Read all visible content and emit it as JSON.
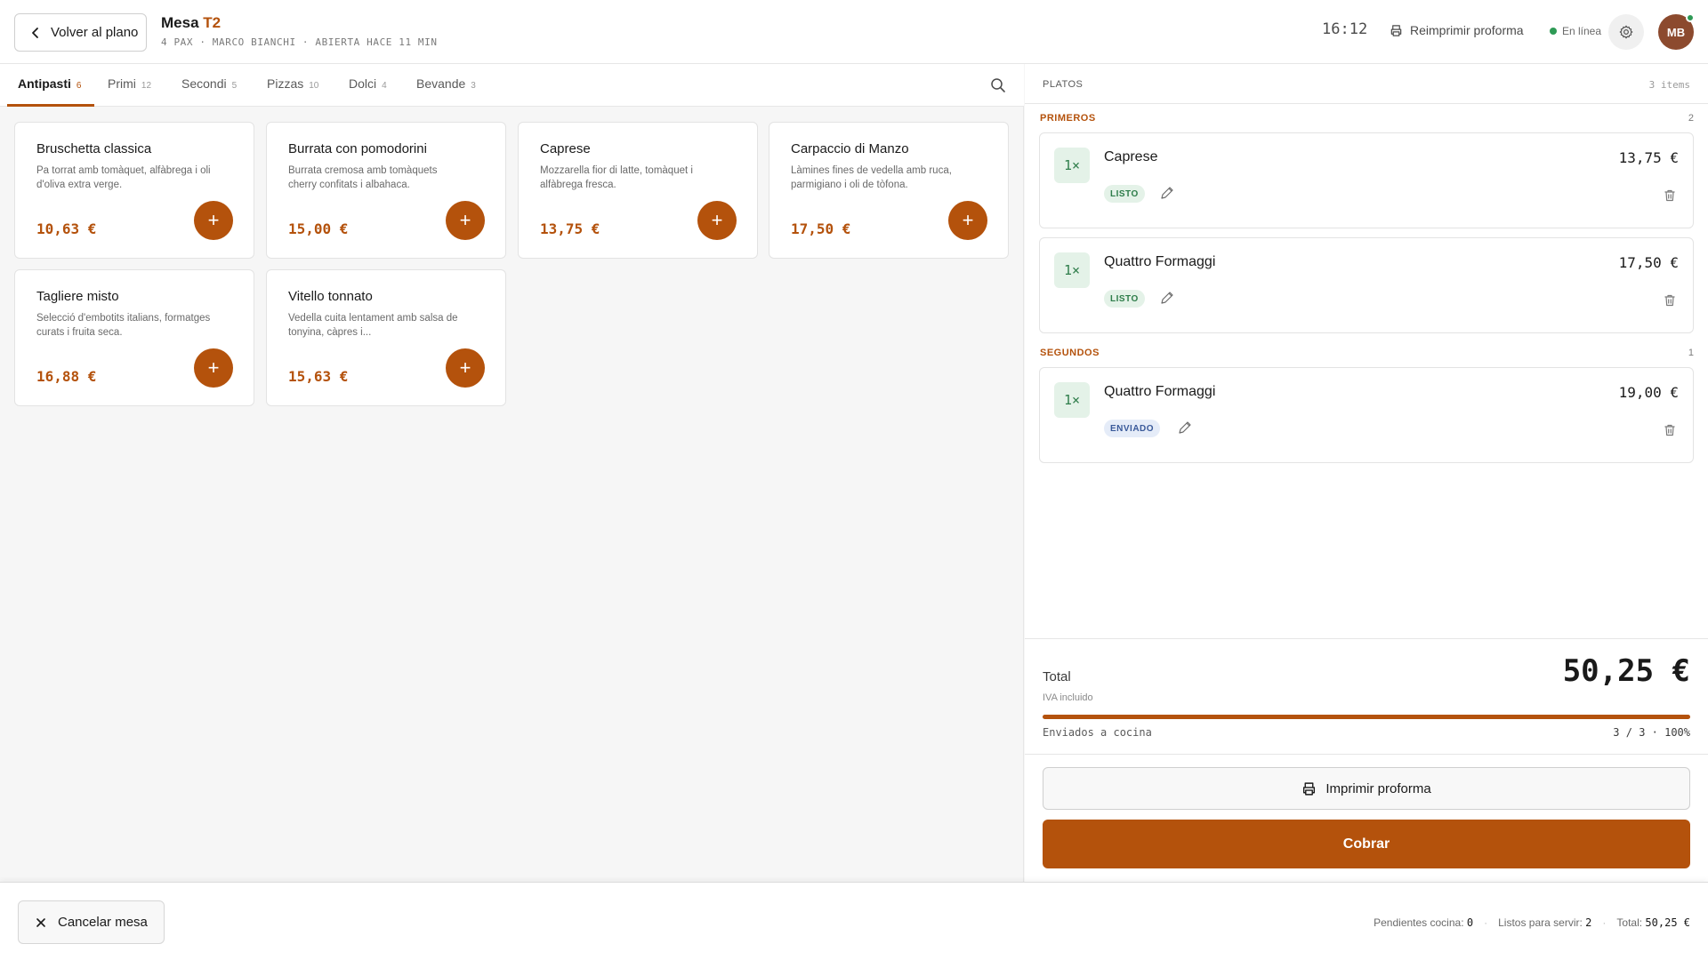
{
  "header": {
    "back_label": "Volver al plano",
    "title_prefix": "Mesa",
    "table_code": "T2",
    "meta": "4 PAX · MARCO BIANCHI · ABIERTA HACE 11 MIN",
    "clock": "16:12",
    "reprint_label": "Reimprimir proforma",
    "online_label": "En línea",
    "avatar_initials": "MB"
  },
  "tabs": [
    {
      "label": "Antipasti",
      "count": "6"
    },
    {
      "label": "Primi",
      "count": "12"
    },
    {
      "label": "Secondi",
      "count": "5"
    },
    {
      "label": "Pizzas",
      "count": "10"
    },
    {
      "label": "Dolci",
      "count": "4"
    },
    {
      "label": "Bevande",
      "count": "3"
    }
  ],
  "products": [
    {
      "name": "Bruschetta classica",
      "desc": "Pa torrat amb tomàquet, alfàbrega i oli d'oliva extra verge.",
      "price": "10,63 €"
    },
    {
      "name": "Burrata con pomodorini",
      "desc": "Burrata cremosa amb tomàquets cherry confitats i albahaca.",
      "price": "15,00 €"
    },
    {
      "name": "Caprese",
      "desc": "Mozzarella fior di latte, tomàquet i alfàbrega fresca.",
      "price": "13,75 €"
    },
    {
      "name": "Carpaccio di Manzo",
      "desc": "Làmines fines de vedella amb ruca, parmigiano i oli de tòfona.",
      "price": "17,50 €"
    },
    {
      "name": "Tagliere misto",
      "desc": "Selecció d'embotits italians, formatges curats i fruita seca.",
      "price": "16,88 €"
    },
    {
      "name": "Vitello tonnato",
      "desc": "Vedella cuita lentament amb salsa de tonyina, càpres i...",
      "price": "15,63 €"
    }
  ],
  "order": {
    "heading": "PLATOS",
    "items_count": "3 items",
    "sections": [
      {
        "label": "PRIMEROS",
        "count": "2",
        "items": [
          {
            "qty": "1×",
            "name": "Caprese",
            "price": "13,75 €",
            "status": "LISTO"
          },
          {
            "qty": "1×",
            "name": "Quattro Formaggi",
            "price": "17,50 €",
            "status": "LISTO"
          }
        ]
      },
      {
        "label": "SEGUNDOS",
        "count": "1",
        "items": [
          {
            "qty": "1×",
            "name": "Quattro Formaggi",
            "price": "19,00 €",
            "status": "ENVIADO"
          }
        ]
      }
    ],
    "total_label": "Total",
    "total_value": "50,25 €",
    "iva_label": "IVA incluido",
    "sent_label": "Enviados a cocina",
    "sent_ratio": "3 / 3 · 100%",
    "sent_progress": 1.0,
    "print_label": "Imprimir proforma",
    "pay_label": "Cobrar"
  },
  "footer": {
    "cancel_label": "Cancelar mesa",
    "pending_label": "Pendientes cocina:",
    "pending_value": "0",
    "ready_label": "Listos para servir:",
    "ready_value": "2",
    "total_label": "Total:",
    "total_value": "50,25 €"
  },
  "colors": {
    "accent": "#b4520c",
    "ready_bg": "#e4f2e8",
    "sent_bg": "#e5ecf8",
    "online": "#2e9a55"
  }
}
